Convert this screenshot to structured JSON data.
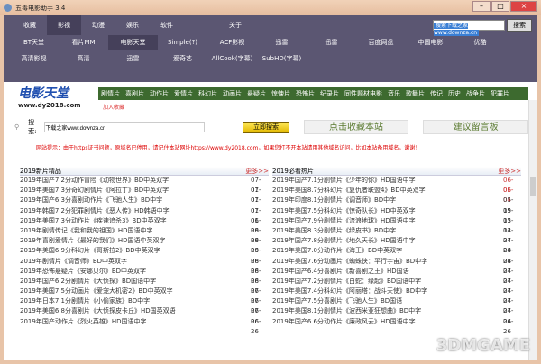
{
  "window": {
    "title": "五毒电影助手 3.4"
  },
  "menu": [
    "收藏",
    "影视",
    "动漫",
    "娱乐",
    "软件",
    "",
    "关于"
  ],
  "menu_active": 1,
  "top_search": {
    "value": "搜索下载之家www.downza.cn",
    "button": "搜索"
  },
  "row2": [
    "BT天堂",
    "看片MM",
    "电影天堂",
    "Simple(?)",
    "ACF影视",
    "迅雷",
    "迅雷",
    "百度网盘",
    "中国电影",
    "优酷"
  ],
  "row3": [
    "高清影视",
    "高清",
    "迅雷",
    "爱奇艺",
    "AllCook(字幕)",
    "SubHD(字幕)"
  ],
  "logo": {
    "title": "电影天堂",
    "url": "www.dy2018.com"
  },
  "fav_link": "加入收藏",
  "categories": [
    "剧情片",
    "喜剧片",
    "动作片",
    "爱情片",
    "科幻片",
    "动画片",
    "悬疑片",
    "惊悚片",
    "恐怖片",
    "纪录片",
    "同性题材电影",
    "音乐",
    "歌舞片",
    "传记",
    "历史",
    "战争片",
    "犯罪片"
  ],
  "search": {
    "label": "搜索:",
    "value": "下载之家www.downza.cn",
    "button": "立即搜索"
  },
  "bookmark_button": "点击收藏本站",
  "guestbook_button": "建议留言板",
  "notice": "网站提示：由于https证书问题，原域名已停用，请记住本站网址https://www.dy2018.com，如果您打不开本站请用其他域名访问，比如本站备用域名，谢谢！",
  "left_list": {
    "title": "2019新片精品",
    "more": "更多>>",
    "items": [
      {
        "t": "2019年国产7.2分动作冒险《动物世界》BD中英双字",
        "d": "07-01"
      },
      {
        "t": "2019年美国7.3分奇幻剧情片《阿拉丁》BD中英双字",
        "d": "07-01"
      },
      {
        "t": "2019年国产6.3分喜剧动作片《飞驰人生》BD中字",
        "d": "07-01"
      },
      {
        "t": "2019年韩国7.2分犯罪剧情片《恶人传》HD韩语中字",
        "d": "07-01"
      },
      {
        "t": "2019年美国7.3分动作片《疾速追杀3》BD中英双字",
        "d": "06-29"
      },
      {
        "t": "2019年剧情传记《我和我的祖国》HD国语中字",
        "d": "06-29"
      },
      {
        "t": "2019年喜剧爱情片《最好的我们》HD国语中英双字",
        "d": "06-29"
      },
      {
        "t": "2019年美国6.9分科幻片《哥斯拉2》BD中英双字",
        "d": "06-28"
      },
      {
        "t": "2019年剧情片《调音师》BD中英双字",
        "d": "06-28"
      },
      {
        "t": "2019年恐怖悬疑片《安娜贝尔》BD中英双字",
        "d": "06-28"
      },
      {
        "t": "2019年国产6.2分剧情片《大侦探》BD国语中字",
        "d": "06-27"
      },
      {
        "t": "2019年美国7.5分动画片《爱宠大机密2》BD中英双字",
        "d": "06-27"
      },
      {
        "t": "2019年日本7.1分剧情片《小偷家族》BD中字",
        "d": "06-27"
      },
      {
        "t": "2019年美国6.8分喜剧片《大侦探皮卡丘》HD国英双语",
        "d": "06-26"
      },
      {
        "t": "2019年国产动作片《烈火英雄》HD国语中字",
        "d": "06-26"
      }
    ]
  },
  "right_list": {
    "title": "2019必看热片",
    "more": "更多>>",
    "items": [
      {
        "t": "2019年国产7.1分剧情片《少年的你》HD国语中字",
        "d": "06-05"
      },
      {
        "t": "2019年美国8.7分科幻片《复仇者联盟4》BD中英双字",
        "d": "06-04"
      },
      {
        "t": "2019年印度8.1分剧情片《调音师》BD中字",
        "d": "05-19"
      },
      {
        "t": "2019年美国7.5分科幻片《惊奇队长》HD中英双字",
        "d": "05-13"
      },
      {
        "t": "2019年国产7.9分剧情片《流浪地球》HD国语中字",
        "d": "05-12"
      },
      {
        "t": "2019年美国8.3分剧情片《绿皮书》BD中字",
        "d": "04-27"
      },
      {
        "t": "2019年国产7.8分剧情片《地久天长》HD国语中字",
        "d": "04-28"
      },
      {
        "t": "2019年美国7.0分动作片《海王》BD中英双字",
        "d": "04-28"
      },
      {
        "t": "2019年美国7.6分动画片《蜘蛛侠：平行宇宙》BD中字",
        "d": "04-27"
      },
      {
        "t": "2019年国产6.4分喜剧片《新喜剧之王》HD国语",
        "d": "04-27"
      },
      {
        "t": "2019年国产7.2分剧情片《白蛇：缘起》BD国语中字",
        "d": "04-27"
      },
      {
        "t": "2019年美国7.4分科幻片《阿丽塔：战斗天使》BD中字",
        "d": "04-27"
      },
      {
        "t": "2019年国产7.5分喜剧片《飞驰人生》BD国语",
        "d": "04-27"
      },
      {
        "t": "2019年美国8.1分剧情片《波西米亚狂想曲》BD中字",
        "d": "04-26"
      },
      {
        "t": "2019年国产6.6分动作片《廉政风云》HD国语中字",
        "d": "04-26"
      }
    ]
  },
  "watermark": "3DMGAME"
}
